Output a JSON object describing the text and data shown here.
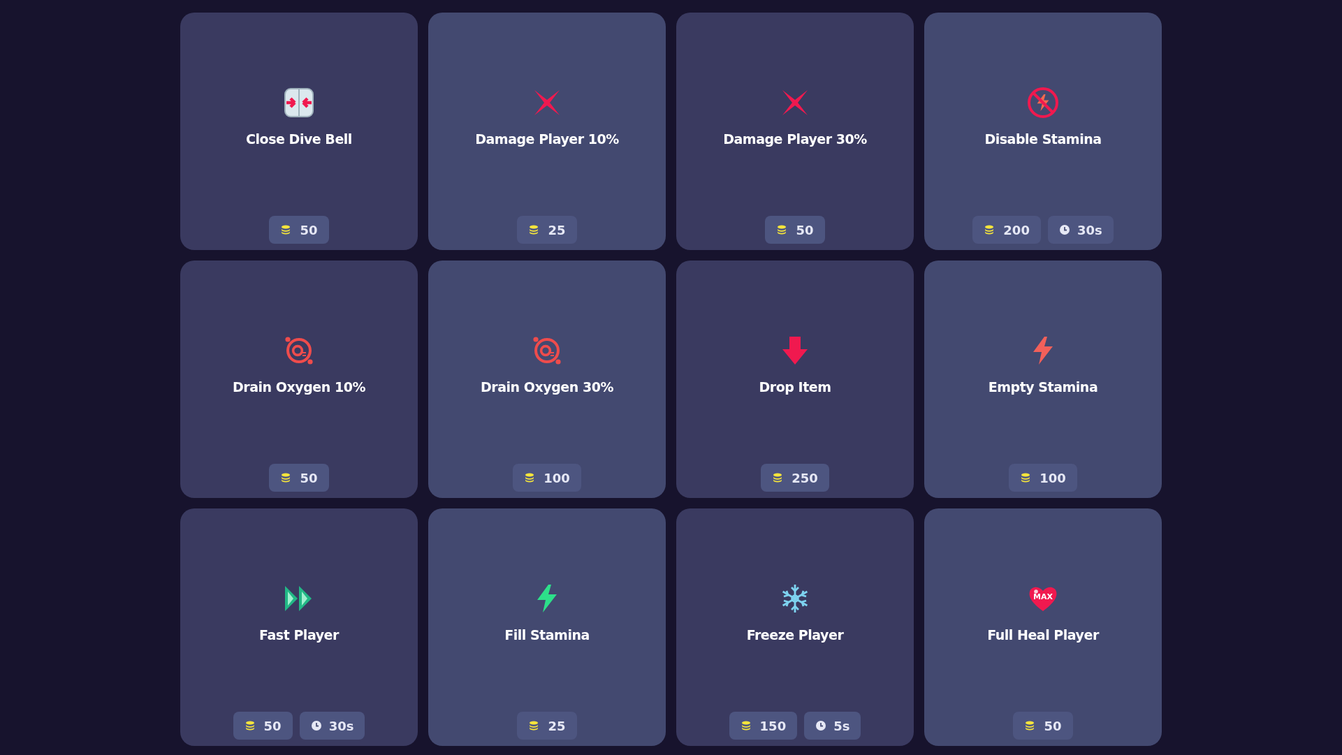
{
  "cards": [
    {
      "title": "Close Dive Bell",
      "kind": "bell-doors",
      "cost": "50"
    },
    {
      "title": "Damage Player 10%",
      "kind": "cross",
      "cost": "25"
    },
    {
      "title": "Damage Player 30%",
      "kind": "cross",
      "cost": "50"
    },
    {
      "title": "Disable Stamina",
      "kind": "no-bolt",
      "cost": "200",
      "duration": "30s"
    },
    {
      "title": "Drain Oxygen 10%",
      "kind": "oxygen",
      "cost": "50"
    },
    {
      "title": "Drain Oxygen 30%",
      "kind": "oxygen",
      "cost": "100"
    },
    {
      "title": "Drop Item",
      "kind": "down-arrow",
      "cost": "250"
    },
    {
      "title": "Empty Stamina",
      "kind": "red-bolt",
      "cost": "100"
    },
    {
      "title": "Fast Player",
      "kind": "fast",
      "cost": "50",
      "duration": "30s"
    },
    {
      "title": "Fill Stamina",
      "kind": "green-bolt",
      "cost": "25"
    },
    {
      "title": "Freeze Player",
      "kind": "snowflake",
      "cost": "150",
      "duration": "5s"
    },
    {
      "title": "Full Heal Player",
      "kind": "heart",
      "icon_text": "MAX",
      "cost": "50"
    }
  ]
}
